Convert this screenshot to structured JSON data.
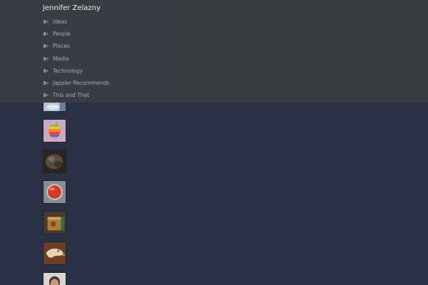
{
  "site": {
    "title": "Jennifer Zelazny"
  },
  "nav": {
    "items": [
      {
        "label": "Ideas"
      },
      {
        "label": "People"
      },
      {
        "label": "Places"
      },
      {
        "label": "Media"
      },
      {
        "label": "Technology"
      },
      {
        "label": "Jappler Recommends"
      },
      {
        "label": "This and That"
      }
    ],
    "bullet_icon": "folder-tab-icon"
  },
  "colors": {
    "page_background": "#2a3045",
    "menu_background": "#3a3d42",
    "title_text": "#f2f2f2",
    "nav_text": "#a9adb4"
  },
  "thumbnails": [
    {
      "icon": "photo-partial-icon"
    },
    {
      "icon": "rainbow-apple-logo-icon"
    },
    {
      "icon": "dark-animal-photo-icon"
    },
    {
      "icon": "red-button-photo-icon"
    },
    {
      "icon": "wooden-box-photo-icon"
    },
    {
      "icon": "greyhound-dog-photo-icon"
    },
    {
      "icon": "person-portrait-photo-icon"
    }
  ]
}
